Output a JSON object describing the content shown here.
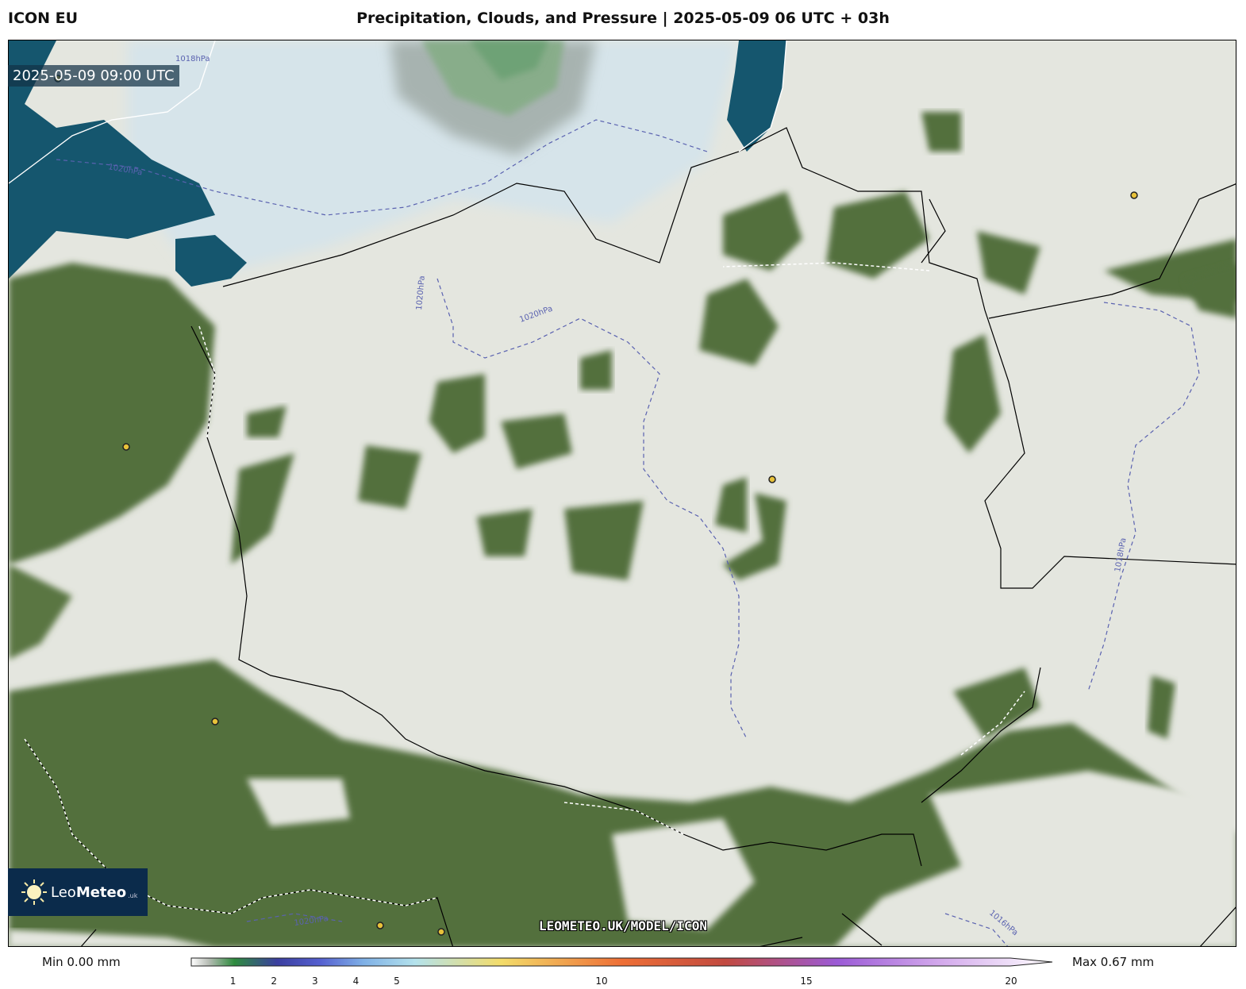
{
  "header": {
    "model": "ICON EU",
    "title": "Precipitation, Clouds, and Pressure | 2025-05-09 06 UTC + 03h"
  },
  "map": {
    "valid_time": "2025-05-09 09:00 UTC",
    "watermark": "LEOMETEO.UK/MODEL/ICON",
    "isobar_labels": [
      "1018hPa",
      "1020hPa",
      "1020hPa",
      "1020hPa",
      "1018hPa",
      "1020hPa",
      "1016hPa"
    ],
    "colors": {
      "sea": "#15566e",
      "land": "#52703c",
      "cloud": "#e4e6df",
      "isobar": "#5a62b0",
      "city_marker": "#e8c23a"
    }
  },
  "logo": {
    "prefix": "Leo",
    "bold": "Meteo",
    "tld": ".uk"
  },
  "legend": {
    "min_label": "Min 0.00 mm",
    "max_label": "Max 0.67 mm",
    "ticks": [
      "1",
      "2",
      "3",
      "4",
      "5",
      "10",
      "15",
      "20"
    ],
    "tick_values": [
      1,
      2,
      3,
      4,
      5,
      10,
      15,
      20
    ],
    "range": [
      0,
      20
    ]
  }
}
